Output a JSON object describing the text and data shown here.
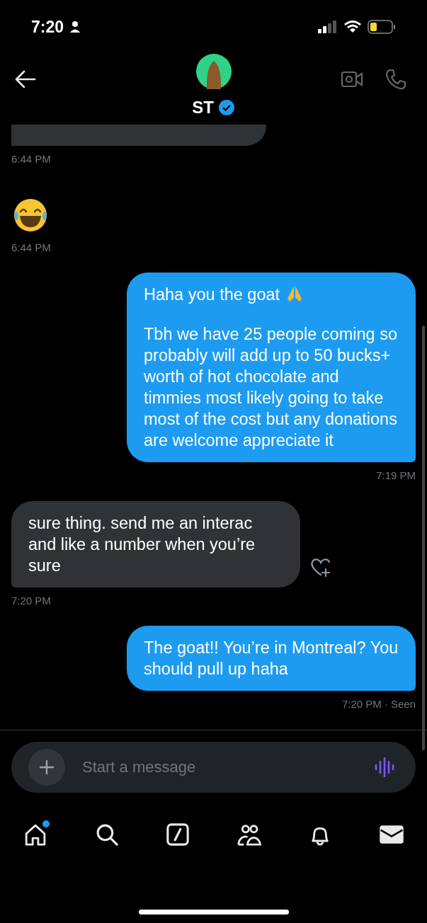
{
  "status_bar": {
    "time": "7:20"
  },
  "header": {
    "name": "ST",
    "verified": true
  },
  "messages": [
    {
      "kind": "fragment",
      "sent": false
    },
    {
      "kind": "time",
      "sent": false,
      "text": "6:44 PM"
    },
    {
      "kind": "emoji",
      "sent": false
    },
    {
      "kind": "time",
      "sent": false,
      "text": "6:44 PM"
    },
    {
      "kind": "text",
      "sent": true,
      "paragraphs": [
        {
          "text": "Haha you the goat",
          "kind": "with-emoji"
        },
        {
          "text": "Tbh we have 25 people coming so probably will add up to 50 bucks+ worth of hot chocolate and timmies most likely going to take most of the cost but any donations are welcome appreciate it",
          "kind": "plain"
        }
      ]
    },
    {
      "kind": "time",
      "sent": true,
      "text": "7:19 PM"
    },
    {
      "kind": "text",
      "sent": false,
      "react": true,
      "paragraphs": [
        {
          "text": "sure thing. send me an interac and like a number when you’re sure",
          "kind": "plain"
        }
      ]
    },
    {
      "kind": "time",
      "sent": false,
      "text": "7:20 PM"
    },
    {
      "kind": "text",
      "sent": true,
      "paragraphs": [
        {
          "text": "The goat!! You’re in Montreal? You should pull up haha",
          "kind": "plain"
        }
      ]
    },
    {
      "kind": "time",
      "sent": true,
      "text": "7:20 PM",
      "status": "· Seen"
    }
  ],
  "composer": {
    "placeholder": "Start a message"
  },
  "nav": [
    {
      "kind": "home",
      "badge": true,
      "selected": false
    },
    {
      "kind": "search",
      "badge": false,
      "selected": false
    },
    {
      "kind": "compose",
      "badge": false,
      "selected": false
    },
    {
      "kind": "people",
      "badge": false,
      "selected": false
    },
    {
      "kind": "bell",
      "badge": false,
      "selected": false
    },
    {
      "kind": "mail",
      "badge": false,
      "selected": true
    }
  ]
}
